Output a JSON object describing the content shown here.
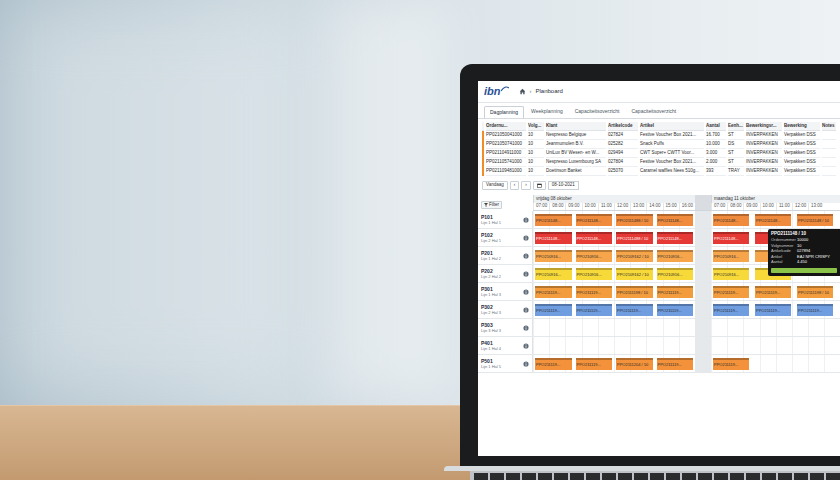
{
  "header": {
    "logo": "ibn",
    "separator": "›",
    "page": "Planboard"
  },
  "tabs": [
    {
      "label": "Dagplanning",
      "selected": true
    },
    {
      "label": "Weekplanning",
      "selected": false
    },
    {
      "label": "Capaciteitsoverzicht",
      "selected": false
    },
    {
      "label": "Capaciteitsoverzicht",
      "selected": false
    }
  ],
  "table": {
    "columns": [
      "Ordernu...",
      "Volg...",
      "Klant",
      "Artikelcode",
      "Artikel",
      "Aantal",
      "Eenh...",
      "Bewerkingsr...",
      "Bewerking",
      "Notes"
    ],
    "rows": [
      [
        "PP021050041000",
        "10",
        "Nespresso Belgique",
        "027824",
        "Festive Voucher Box 2021...",
        "16.700",
        "ST",
        "INVERPAKKEN",
        "Verpakken DSS"
      ],
      [
        "PP021050741000",
        "10",
        "Jeanmumolen B.V.",
        "025282",
        "Snack Puffs",
        "10.000",
        "DS",
        "INVERPAKKEN",
        "Verpakken DSS"
      ],
      [
        "PP021104911000",
        "10",
        "UniLux BV Wesen- en W...",
        "029494",
        "CWT Super+ CWTT Voor...",
        "3.000",
        "ST",
        "INVERPAKKEN",
        "Verpakken DSS"
      ],
      [
        "PP021105741000",
        "10",
        "Nespresso Luxembourg SA",
        "027804",
        "Festive Voucher Box 2021...",
        "2.000",
        "ST",
        "INVERPAKKEN",
        "Verpakken DSS"
      ],
      [
        "PP021109481000",
        "10",
        "Doetinson Banket",
        "025070",
        "Caramel waffles Nees 510g...",
        "393",
        "TRAY",
        "INVERPAKKEN",
        "Verpakken DSS"
      ]
    ]
  },
  "toolbar": {
    "today": "Vandaag",
    "prev": "‹",
    "next": "›",
    "date": "08-10-2021"
  },
  "planboard": {
    "filter": "Filter",
    "days": [
      {
        "label": "vrijdag 08 oktober",
        "hours": [
          "07:00",
          "08:00",
          "09:00",
          "10:00",
          "11:00",
          "12:00",
          "13:00",
          "14:00",
          "15:00",
          "16:00"
        ]
      },
      {
        "label": "maandag 11 oktober",
        "hours": [
          "07:00",
          "08:00",
          "09:00",
          "10:00",
          "11:00",
          "12:00",
          "13:00"
        ]
      }
    ],
    "lines": [
      {
        "name": "P101",
        "sub": "Lijn 1 Hal 1",
        "color": "#f08a3c",
        "blocks": [
          {
            "slot": 0,
            "text": "PPO211148..."
          },
          {
            "slot": 1,
            "text": "PPO211148..."
          },
          {
            "slot": 2,
            "text": "PPO2111488 / 10"
          },
          {
            "slot": 3,
            "text": "PPO211148..."
          },
          {
            "slot": 4,
            "text": "PPO211148..."
          },
          {
            "slot": 5,
            "text": "PPO211148..."
          },
          {
            "slot": 6,
            "text": "PPO2111148 / 10"
          }
        ]
      },
      {
        "name": "P102",
        "sub": "Lijn 2 Hal 1",
        "color": "#e53935",
        "blocks": [
          {
            "slot": 0,
            "text": "PPO211148..."
          },
          {
            "slot": 1,
            "text": "PPO211148..."
          },
          {
            "slot": 2,
            "text": "PPO2111488 / 10"
          },
          {
            "slot": 3,
            "text": "PPO211148..."
          },
          {
            "slot": 4,
            "text": "PPO211148..."
          },
          {
            "slot": 5
          }
        ]
      },
      {
        "name": "P201",
        "sub": "Lijn 1 Hal 2",
        "color": "#f6a54b",
        "blocks": [
          {
            "slot": 0,
            "text": "PPO210916..."
          },
          {
            "slot": 1,
            "text": "PPO210916..."
          },
          {
            "slot": 2,
            "text": "PPO2109162 / 10"
          },
          {
            "slot": 3,
            "text": "PPO210916..."
          },
          {
            "slot": 4,
            "text": "PPO210916..."
          },
          {
            "slot": 5
          }
        ]
      },
      {
        "name": "P202",
        "sub": "Lijn 2 Hal 2",
        "color": "#f8d93a",
        "blocks": [
          {
            "slot": 0,
            "text": "PPO210916..."
          },
          {
            "slot": 1,
            "text": "PPO210916..."
          },
          {
            "slot": 2,
            "text": "PPO2109162 / 10"
          },
          {
            "slot": 3,
            "text": "PPO210916..."
          },
          {
            "slot": 4,
            "text": "PPO210916..."
          },
          {
            "slot": 5
          }
        ]
      },
      {
        "name": "P301",
        "sub": "Lijn 1 Hal 3",
        "color": "#f39c3d",
        "blocks": [
          {
            "slot": 0,
            "text": "PPO211119..."
          },
          {
            "slot": 1,
            "text": "PPO211119..."
          },
          {
            "slot": 2,
            "text": "PPO2111198 / 10"
          },
          {
            "slot": 3,
            "text": "PPO211119..."
          },
          {
            "slot": 4,
            "text": "PPO211119..."
          },
          {
            "slot": 5,
            "text": "PPO211119..."
          },
          {
            "slot": 6,
            "text": "PPO2111198 / 10"
          }
        ]
      },
      {
        "name": "P302",
        "sub": "Lijn 2 Hal 3",
        "color": "#6f9de0",
        "blocks": [
          {
            "slot": 0,
            "text": "PPO211119..."
          },
          {
            "slot": 1,
            "text": "PPO211119..."
          },
          {
            "slot": 2,
            "text": "PPO211119..."
          },
          {
            "slot": 3,
            "text": "PPO211119..."
          },
          {
            "slot": 4,
            "text": "PPO211119..."
          },
          {
            "slot": 5,
            "text": "PPO211119..."
          },
          {
            "slot": 6,
            "text": "PPO211119..."
          }
        ]
      },
      {
        "name": "P303",
        "sub": "Lijn 3 Hal 3",
        "color": "#f39c3d",
        "blocks": []
      },
      {
        "name": "P401",
        "sub": "Lijn 1 Hal 4",
        "color": "#f39c3d",
        "blocks": []
      },
      {
        "name": "P501",
        "sub": "Lijn 1 Hal 5",
        "color": "#f3923a",
        "blocks": [
          {
            "slot": 0,
            "text": "PPO211119..."
          },
          {
            "slot": 1,
            "text": "PPO211119..."
          },
          {
            "slot": 2,
            "text": "PPO2111204 / 10"
          },
          {
            "slot": 3,
            "text": "PPO211119..."
          },
          {
            "slot": 4,
            "text": "PPO211119..."
          }
        ]
      }
    ]
  },
  "tooltip": {
    "title": "PPO2111148 / 10",
    "fields": [
      {
        "label": "Ordernummer",
        "value": "10000"
      },
      {
        "label": "Volgnummer",
        "value": "10"
      },
      {
        "label": "Artikelcode",
        "value": "027894"
      },
      {
        "label": "Artikel",
        "value": "EAJ NPR CRISPY"
      },
      {
        "label": "Aantal",
        "value": "4.450"
      }
    ],
    "level": 1
  }
}
